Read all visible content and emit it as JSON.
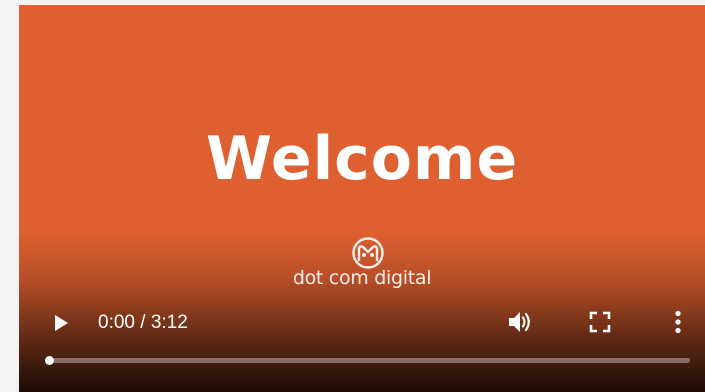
{
  "video": {
    "background_color": "#de5f2f",
    "title_text": "Welcome",
    "brand": {
      "logo_icon": "dot-com-digital-logo-icon",
      "name": "dot com digital"
    }
  },
  "controls": {
    "play_icon": "play-icon",
    "current_time": "0:00",
    "separator": " / ",
    "duration": "3:12",
    "volume_icon": "volume-icon",
    "fullscreen_icon": "fullscreen-icon",
    "more_icon": "more-options-icon",
    "progress_fraction": 0.0
  }
}
